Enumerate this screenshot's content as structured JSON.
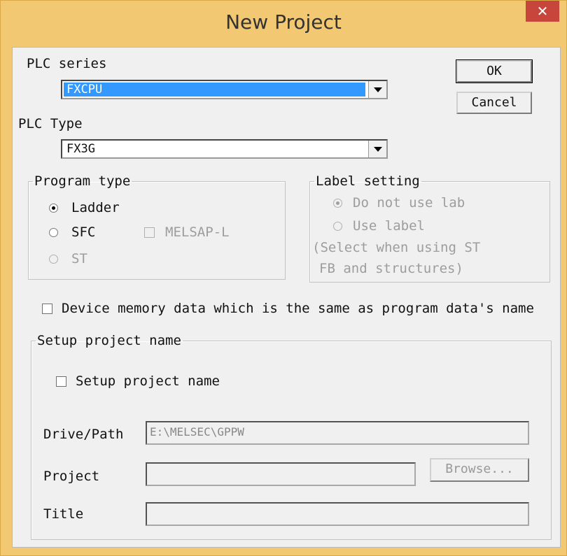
{
  "window": {
    "title": "New Project",
    "close_glyph": "✕"
  },
  "plc_series": {
    "label": "PLC series",
    "value": "FXCPU"
  },
  "plc_type": {
    "label": "PLC Type",
    "value": "FX3G"
  },
  "buttons": {
    "ok": "OK",
    "cancel": "Cancel",
    "browse": "Browse..."
  },
  "program_type": {
    "legend": "Program type",
    "ladder": "Ladder",
    "sfc": "SFC",
    "melsap": "MELSAP-L",
    "st": "ST",
    "selected": "Ladder"
  },
  "label_setting": {
    "legend": "Label setting",
    "do_not_use": "Do not use lab",
    "use_label": "Use label",
    "note_line1": "(Select when using ST",
    "note_line2": "FB and structures)"
  },
  "device_memory": {
    "label": "Device memory data which is the same as program data's name",
    "checked": false
  },
  "setup": {
    "legend": "Setup project name",
    "checkbox_label": "Setup project name",
    "checked": false,
    "drive_path_label": "Drive/Path",
    "drive_path_value": "E:\\MELSEC\\GPPW",
    "project_label": "Project",
    "project_value": "",
    "title_label": "Title",
    "title_value": ""
  },
  "colors": {
    "title_bar": "#f3c872",
    "close_button": "#c7453b",
    "selection": "#3399ff"
  }
}
